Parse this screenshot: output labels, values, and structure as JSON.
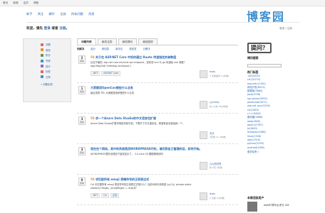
{
  "topbar": {
    "items": [
      "首页",
      "新闻",
      "会员",
      "博客"
    ]
  },
  "nav": {
    "items": [
      "新手",
      "关注",
      "精华",
      "全部",
      "所有问题",
      "消息"
    ]
  },
  "logo": {
    "text": "博客园"
  },
  "welcome": {
    "prefix": "欢迎，请先",
    "login": "登录",
    "or": "或者",
    "register": "注册",
    "suffix": "。"
  },
  "user_links": {
    "text": "登录 / 注册"
  },
  "sidebar": {
    "items": [
      {
        "label": "问题",
        "icon": "question-icon",
        "color": "#d66"
      },
      {
        "label": "悬赏",
        "icon": "reward-icon",
        "color": "#e98a2a"
      },
      {
        "label": "积分",
        "icon": "score-icon",
        "color": "#5a9a3a"
      },
      {
        "label": "专家",
        "icon": "expert-icon",
        "color": "#3d8fd0"
      },
      {
        "label": "排行",
        "icon": "rank-icon",
        "color": "#8a6ab4"
      },
      {
        "label": "标签",
        "icon": "tag-icon",
        "color": "#d66"
      },
      {
        "label": "文章",
        "icon": "doc-icon",
        "color": "#3d8fd0"
      }
    ],
    "bottom": "» 问题反馈"
  },
  "tabs": [
    "问题列表",
    "我关注的",
    "我的提问",
    "我回答的"
  ],
  "subtabs": [
    "待解决",
    "高分",
    "新回答",
    "新评论",
    "零回答",
    "已解决"
  ],
  "questions": [
    {
      "count": "2",
      "count_label": "回答",
      "reward": "50",
      "title": "关于在 ASP.NET Core 中如何通过 Route 传递指定的参数值",
      "desc": "比如下面的: asp.net core minimal api endpoint，如何将 xml 与 go 传递给 xml 参数？app.MapGet(\"/sitemap.xml&quot;)",
      "tags": [
        ".NET",
        "ASP.NET Core"
      ],
      "user": "dudu",
      "time": "5 天前提问 1小时前"
    },
    {
      "count": "1",
      "count_label": "回答",
      "reward": "",
      "title": "大家都用OpenCsv做些什么业务",
      "desc": "最近发现 TRL 大家都是用来做些什么业务",
      "tags": [],
      "user": "yyyhaiiy",
      "time": "约 1小时 38小时前"
    },
    {
      "count": "3",
      "count_label": "回答",
      "reward": "50",
      "title": "求一个Azure Data Studio的中文语言包扩展",
      "desc": "Azure Data Studio扩展市场如何找不到。下载不了中文语言包，希望有高手能给我一个。",
      "tags": [],
      "user": "天天",
      "time": "3天前 12 小时前"
    },
    {
      "count": "3",
      "count_label": "回答",
      "reward": "",
      "title": "现在在个网站，其中的系统是用WORDPRESS开的，请问我自己管理的话，如何开始。",
      "desc": "WORDPRESS表的出现如下高效显示了。 2.0.Core 20 要配置网站吗",
      "tags": [],
      "user": "九九的世界",
      "time": "约 2天 4天前"
    },
    {
      "count": "0",
      "count_label": "回答",
      "reward": "50",
      "title": "求匹配所有 emoji 表情符号的正则表达式",
      "desc": "C# 中匹配所有 emoji 表情符号的正则表达式是什么？目前代码中用的是 \\p{Cs} private static readonly Regex _emojiRegex = new(@\"",
      "tags": [
        ".NET",
        "C#",
        "正则"
      ],
      "user": "dudu",
      "time": "1 天前 2小时前"
    }
  ],
  "right": {
    "ask_button": "提问？",
    "search_title": "博问搜索",
    "tags_title": "热门标签",
    "tags": [
      ".net(2029)",
      "c#(12274)",
      "asp.net(11161)",
      "网站开发(8523)",
      "数据库(5880)",
      "java(3726)",
      "sql server(3550)",
      "javascript(3471)",
      "asp.net mvc(3155)",
      "c#(1483)",
      "c++(3426)",
      "服务器(2868)",
      "web(1845)",
      "jquery(1787)",
      "js(1800)",
      "windows(1588)",
      "linux(1528)",
      "ajax(1510)",
      "python(1259)",
      "android(1089)"
    ],
    "more": "更多标签 »",
    "active_title": "本周活跃用户",
    "active_user": "dotNET跨平台 积分 185"
  }
}
